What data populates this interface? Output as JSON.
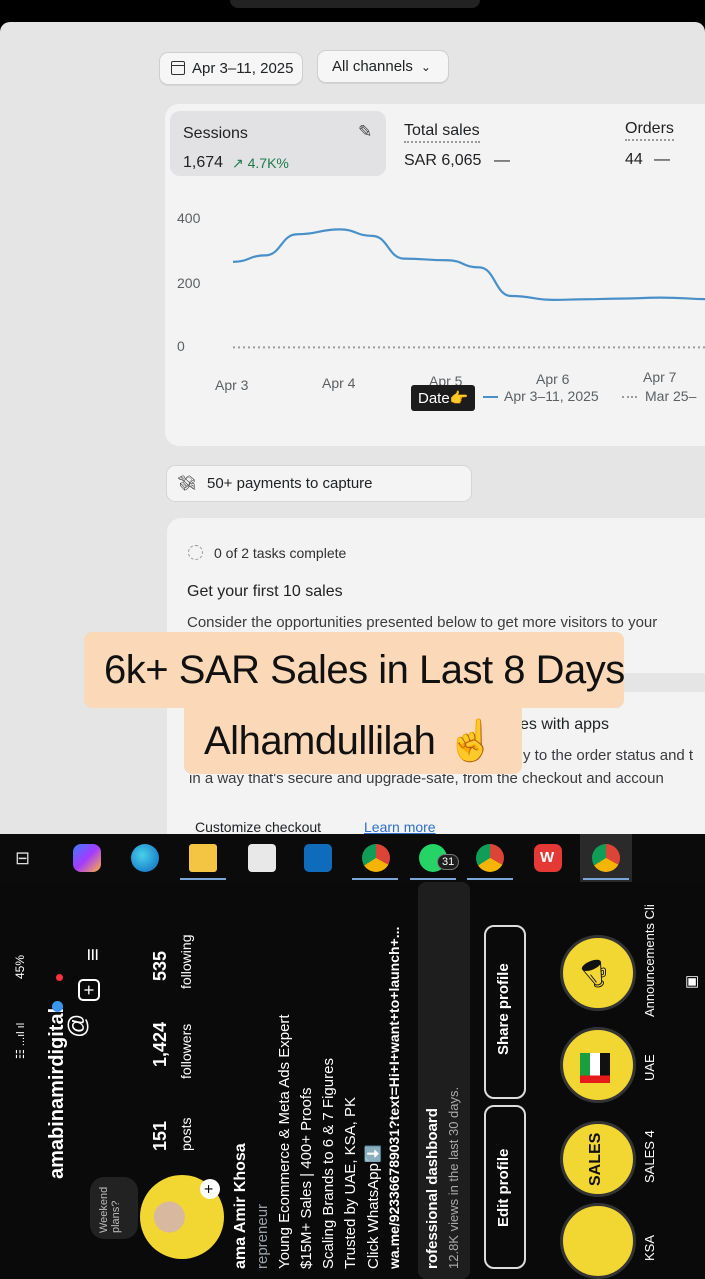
{
  "dashboard": {
    "date_range_button": "Apr 3–11, 2025",
    "channels_dropdown": "All channels",
    "metrics": [
      {
        "label": "Sessions",
        "value": "1,674",
        "change": "↗ 4.7K%"
      },
      {
        "label": "Total sales",
        "value": "SAR 6,065",
        "change": "—"
      },
      {
        "label": "Orders",
        "value": "44",
        "change": "—"
      }
    ],
    "chart_data": {
      "type": "line",
      "x_categories": [
        "Apr 3",
        "Apr 4",
        "Apr 5",
        "Apr 6",
        "Apr 7"
      ],
      "y_ticks": [
        "400",
        "200",
        "0"
      ],
      "ylim": [
        0,
        400
      ],
      "series": [
        {
          "name": "Apr 3–11, 2025",
          "style": "solid",
          "color": "#4a90c8",
          "x": [
            3.0,
            3.3,
            3.6,
            4.0,
            4.3,
            4.6,
            5.0,
            5.3,
            5.6,
            6.0,
            6.3,
            6.6,
            7.0,
            7.5
          ],
          "y": [
            265,
            285,
            350,
            365,
            345,
            275,
            270,
            248,
            160,
            148,
            150,
            152,
            155,
            150
          ]
        },
        {
          "name": "Mar 25–",
          "style": "dotted",
          "color": "#9a9ca0",
          "x": [
            3.0,
            7.5
          ],
          "y": [
            2,
            2
          ]
        }
      ],
      "legend": [
        {
          "label": "Apr 3–11, 2025",
          "style": "solid"
        },
        {
          "label": "Mar 25–",
          "style": "dotted"
        }
      ]
    },
    "date_badge": "Date👉",
    "payments_banner": "50+ payments to capture",
    "tasks_progress": "0 of 2 tasks complete",
    "tasks_title": "Get your first 10 sales",
    "tasks_desc": "Consider the opportunities presented below to get more visitors to your",
    "apps_title": "es with apps",
    "apps_desc_1": "y to the order status and t",
    "apps_desc_2": "in a way that's secure and upgrade-safe, from the checkout and accoun",
    "customize_link": "Customize checkout",
    "learn_more": "Learn more"
  },
  "overlay": {
    "line1": "6k+ SAR Sales in Last 8 Days",
    "line2": "Alhamdullilah ☝️"
  },
  "taskbar": {
    "whatsapp_badge": "31",
    "icons": [
      "task-view-icon",
      "copilot-icon",
      "edge-icon",
      "file-explorer-icon",
      "microsoft-store-icon",
      "outlook-icon",
      "chrome-icon",
      "whatsapp-icon",
      "chrome-profile-icon",
      "wps-office-icon",
      "chrome-profile-2-icon"
    ]
  },
  "profile": {
    "status_bar": "45%",
    "username": "amabinamirdigital",
    "weekend_note": "Weekend plans?",
    "stats": [
      {
        "value": "151",
        "label": "posts"
      },
      {
        "value": "1,424",
        "label": "followers"
      },
      {
        "value": "535",
        "label": "following"
      }
    ],
    "name": "ama Amir Khosa",
    "category": "repreneur",
    "bio": [
      "Young Ecommerce & Meta Ads Expert",
      "$15M+ Sales | 400+ Proofs",
      "Scaling Brands to 6 & 7 Figures",
      "Trusted by UAE, KSA, PK",
      "Click WhatsApp⬇️",
      "wa.me/923366789031?text=Hi+I+want+to+launch+..."
    ],
    "dashboard_title": "rofessional dashboard",
    "dashboard_sub": "12.8K views in the last 30 days.",
    "edit_profile": "Edit profile",
    "share_profile": "Share profile",
    "highlights": [
      {
        "label": "KSA",
        "art": "KSA"
      },
      {
        "label": "SALES 4",
        "art": "SALES"
      },
      {
        "label": "UAE",
        "art": ""
      },
      {
        "label": "Announcements Cli",
        "art": ""
      }
    ]
  }
}
